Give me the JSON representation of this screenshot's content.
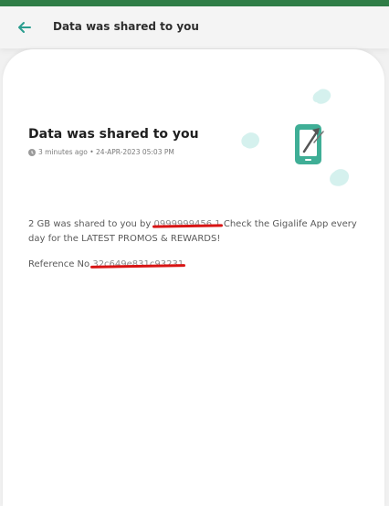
{
  "header": {
    "title": "Data was shared to you"
  },
  "message": {
    "title": "Data was shared to you",
    "meta": "3 minutes ago • 24-APR-2023 05:03 PM",
    "body_prefix": "2 GB  was shared to you by",
    "sender_redacted": "0999999456 1",
    "body_suffix": "Check the Gigalife App every day for the LATEST PROMOS & REWARDS!",
    "reference_label": "Reference No",
    "reference_redacted": "32c649e831c93231"
  },
  "colors": {
    "status_bar": "#2f7d46",
    "accent": "#2a9d8f",
    "redaction": "#d81414"
  },
  "icons": {
    "back": "arrow-left-icon",
    "clock": "clock-icon",
    "illustration": "phone-share-icon"
  }
}
